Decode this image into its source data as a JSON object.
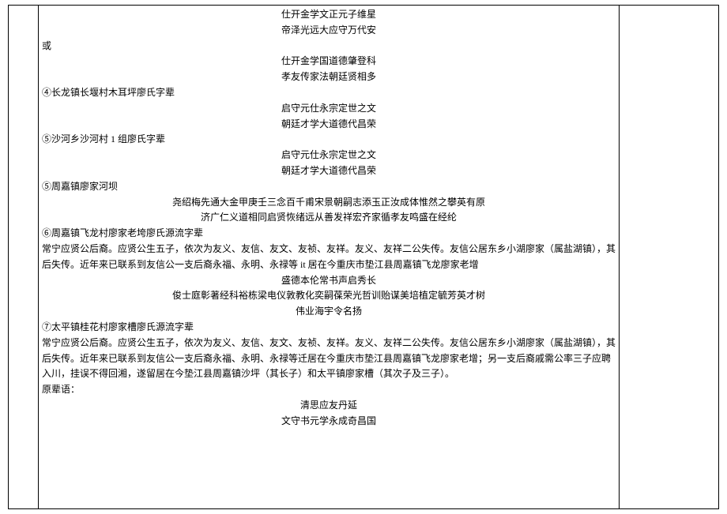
{
  "main": {
    "couplet1a": "仕开金学文正元子维星",
    "couplet1b": "帝泽光远大应守万代安",
    "or": "或",
    "couplet2a": "仕开金学国道德肇登科",
    "couplet2b": "孝友传家法朝廷贤相多",
    "sec4title": "④长龙镇长堰村木耳坪廖氏字辈",
    "couplet4a": "启守元仕永宗定世之文",
    "couplet4b": "朝廷才学大道德代昌荣",
    "sec5atitle": "⑤沙河乡沙河村 1 组廖氏字辈",
    "couplet5aa": "启守元仕永宗定世之文",
    "couplet5ab": "朝廷才学大道德代昌荣",
    "sec5btitle": "⑤周嘉镇廖家河坝",
    "couplet5b1": "尧绍梅先通大金甲庚壬三念百千甫宋景朝嗣志添玉正汝成体惟然之攀英有原",
    "couplet5b2": "济广仁义道相同启贤恢绪远从善发祥宏齐家循孝友鸣盛在经纶",
    "sec6title": "⑥周嘉镇飞龙村廖家老垮廖氏源流字辈",
    "sec6p": "常宁应贤公后裔。应贤公生五子，依次为友义、友信、友文、友祯、友祥。友义、友祥二公失传。友信公居东乡小湖廖家（属盐湖镇），其后失传。近年来已联系到友信公一支后裔永福、永明、永禄等 it 居在今重庆市垫江县周嘉镇飞龙廖家老增",
    "couplet6a": "盛德本伦常书声启秀长",
    "couplet6b": "俊士庭彰著经科裕栋梁电仪敦教化奕嗣葆荣光哲训贻谋美培植定毓芳英才树",
    "couplet6c": "伟业海宇令名扬",
    "sec7title": "⑦太平镇桂花村廖家槽廖氏源流字辈",
    "sec7p": "常宁应贤公后裔。应贤公生五子，依次为友义、友信、友文、友祯、友祥。友义、友祥二公失传。友信公居东乡小湖廖家（属盐湖镇），其后失传。近年来已联系到友信公一支后裔永福、永明、永禄等迁居在今重庆市垫江县周嘉镇飞龙廖家老增；另一支后裔戚需公率三子应聘入川，挂误不得回湘，遂留居在今垫江县周嘉镇沙坪（其长子）和太平镇廖家槽（其次子及三子）。",
    "sec7orig": "原辈语：",
    "couplet7a": "清思应友丹延",
    "couplet7b": "文守书元学永成奇昌国"
  }
}
